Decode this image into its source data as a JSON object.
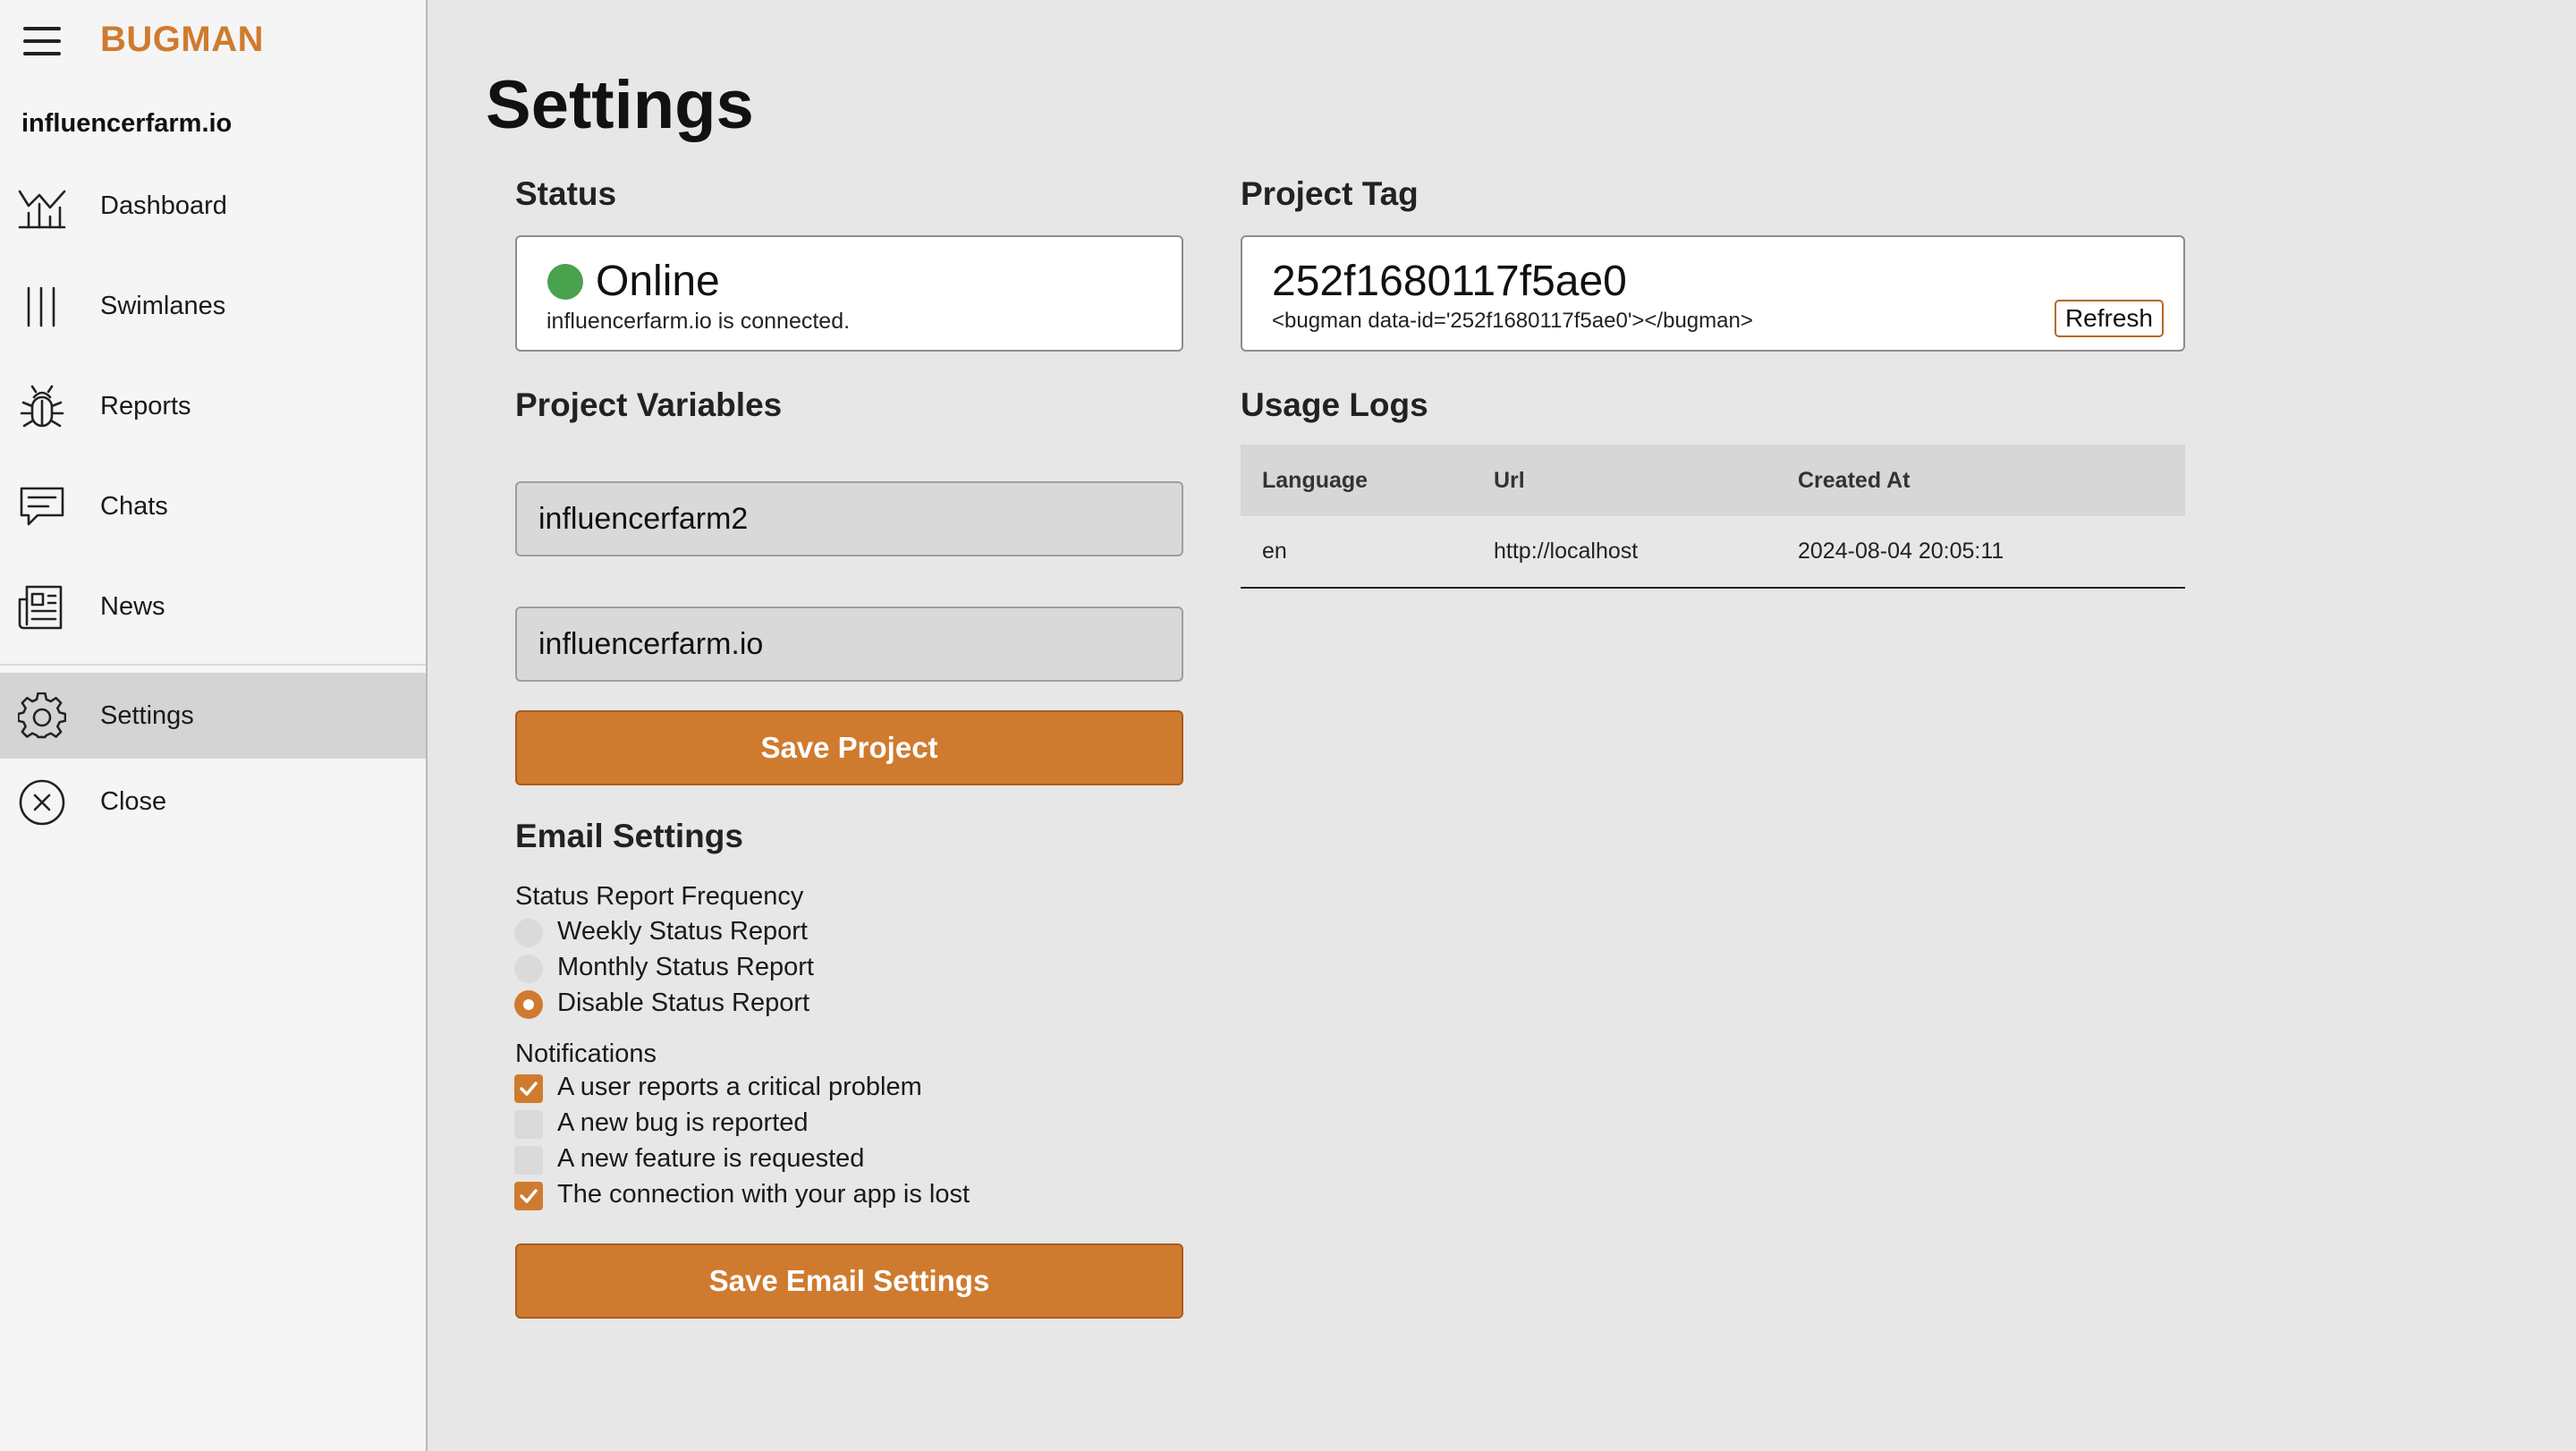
{
  "app": {
    "brand": "BUGMAN",
    "project_name": "influencerfarm.io"
  },
  "sidebar": {
    "items": [
      {
        "id": "dashboard",
        "label": "Dashboard",
        "icon": "dashboard-chart-icon",
        "active": false
      },
      {
        "id": "swimlanes",
        "label": "Swimlanes",
        "icon": "swimlanes-icon",
        "active": false
      },
      {
        "id": "reports",
        "label": "Reports",
        "icon": "bug-icon",
        "active": false
      },
      {
        "id": "chats",
        "label": "Chats",
        "icon": "chat-icon",
        "active": false
      },
      {
        "id": "news",
        "label": "News",
        "icon": "newspaper-icon",
        "active": false
      },
      {
        "id": "settings",
        "label": "Settings",
        "icon": "gear-icon",
        "active": true
      },
      {
        "id": "close",
        "label": "Close",
        "icon": "close-circle-icon",
        "active": false
      }
    ]
  },
  "page": {
    "title": "Settings"
  },
  "status": {
    "title": "Status",
    "value": "Online",
    "description": "influencerfarm.io is connected.",
    "color": "#4aa14e"
  },
  "project_tag": {
    "title": "Project Tag",
    "value": "252f1680117f5ae0",
    "snippet": "<bugman data-id='252f1680117f5ae0'></bugman>",
    "refresh_label": "Refresh"
  },
  "project_variables": {
    "title": "Project Variables",
    "name_value": "influencerfarm2",
    "domain_value": "influencerfarm.io",
    "save_label": "Save Project"
  },
  "email_settings": {
    "title": "Email Settings",
    "frequency_label": "Status Report Frequency",
    "frequency_options": [
      {
        "label": "Weekly Status Report",
        "selected": false
      },
      {
        "label": "Monthly Status Report",
        "selected": false
      },
      {
        "label": "Disable Status Report",
        "selected": true
      }
    ],
    "notifications_label": "Notifications",
    "notifications": [
      {
        "label": "A user reports a critical problem",
        "checked": true
      },
      {
        "label": "A new bug is reported",
        "checked": false
      },
      {
        "label": "A new feature is requested",
        "checked": false
      },
      {
        "label": "The connection with your app is lost",
        "checked": true
      }
    ],
    "save_label": "Save Email Settings"
  },
  "usage_logs": {
    "title": "Usage Logs",
    "columns": [
      "Language",
      "Url",
      "Created At"
    ],
    "rows": [
      [
        "en",
        "http://localhost",
        "2024-08-04 20:05:11"
      ]
    ]
  },
  "colors": {
    "accent": "#cf7b2f",
    "sidebar_bg": "#f5f5f5",
    "page_bg": "#e7e7e7",
    "active_nav": "#d4d4d4"
  }
}
